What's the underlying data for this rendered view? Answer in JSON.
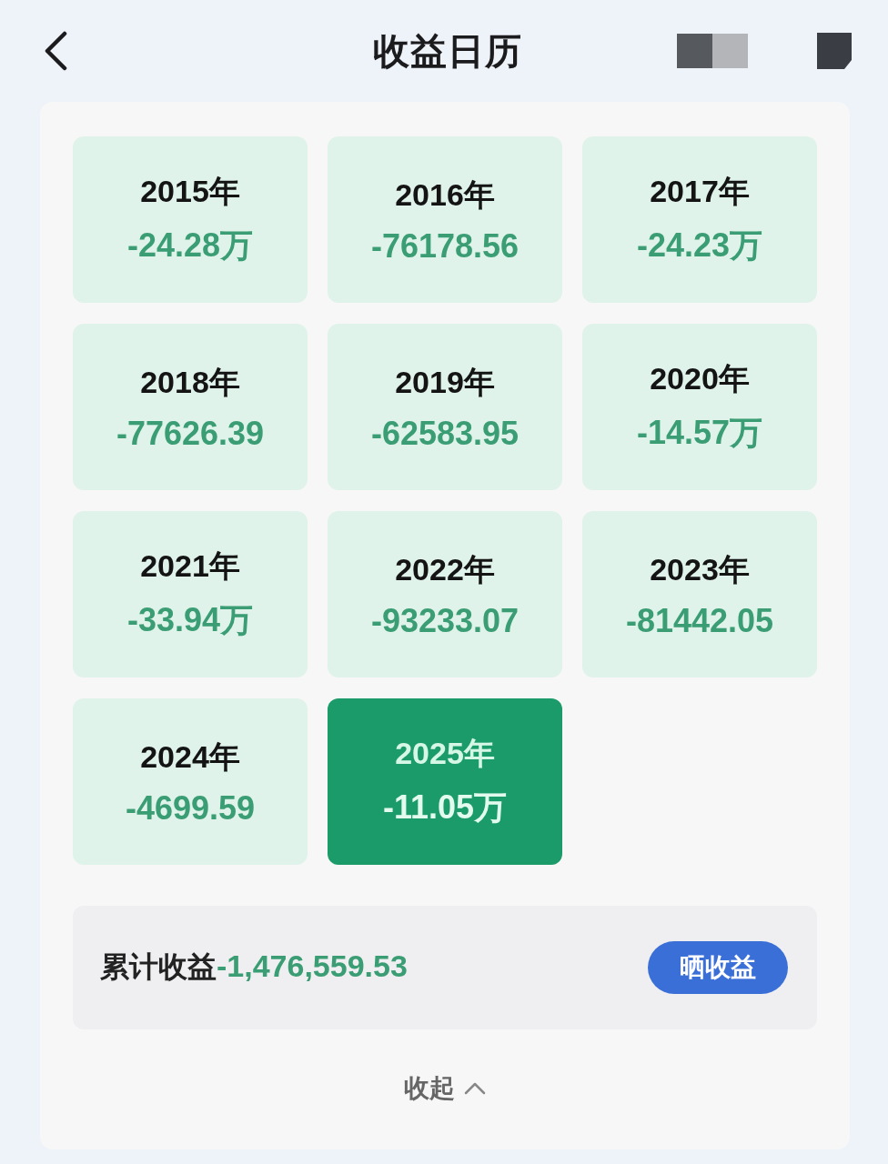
{
  "header": {
    "title": "收益日历"
  },
  "years": [
    {
      "year": "2015年",
      "profit": "-24.28万",
      "selected": false
    },
    {
      "year": "2016年",
      "profit": "-76178.56",
      "selected": false
    },
    {
      "year": "2017年",
      "profit": "-24.23万",
      "selected": false
    },
    {
      "year": "2018年",
      "profit": "-77626.39",
      "selected": false
    },
    {
      "year": "2019年",
      "profit": "-62583.95",
      "selected": false
    },
    {
      "year": "2020年",
      "profit": "-14.57万",
      "selected": false
    },
    {
      "year": "2021年",
      "profit": "-33.94万",
      "selected": false
    },
    {
      "year": "2022年",
      "profit": "-93233.07",
      "selected": false
    },
    {
      "year": "2023年",
      "profit": "-81442.05",
      "selected": false
    },
    {
      "year": "2024年",
      "profit": "-4699.59",
      "selected": false
    },
    {
      "year": "2025年",
      "profit": "-11.05万",
      "selected": true
    }
  ],
  "summary": {
    "label": "累计收益",
    "value": "-1,476,559.53",
    "button": "晒收益"
  },
  "collapse": {
    "label": "收起"
  }
}
